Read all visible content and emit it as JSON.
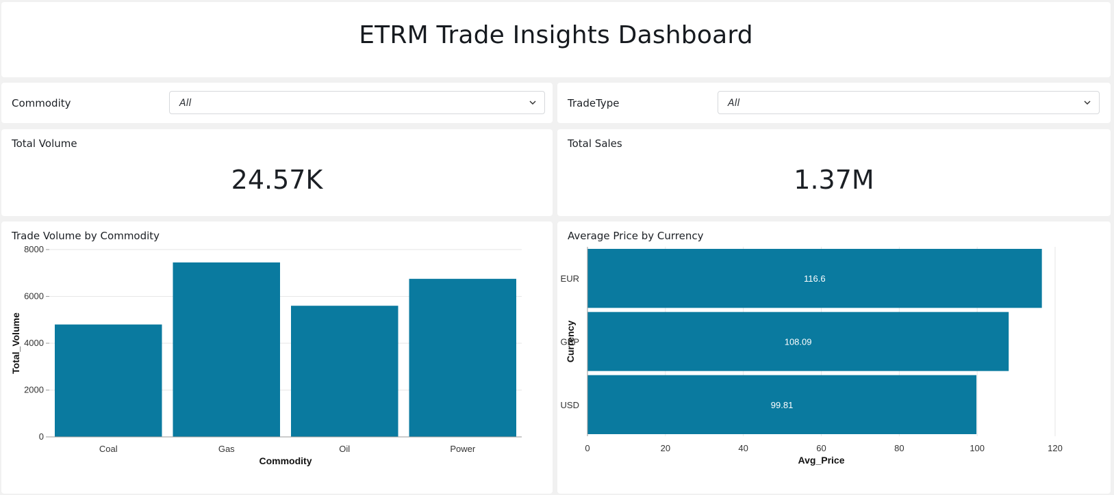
{
  "header": {
    "title": "ETRM Trade Insights Dashboard"
  },
  "filters": {
    "commodity": {
      "label": "Commodity",
      "value": "All"
    },
    "tradetype": {
      "label": "TradeType",
      "value": "All"
    }
  },
  "kpis": {
    "total_volume": {
      "label": "Total Volume",
      "value": "24.57K"
    },
    "total_sales": {
      "label": "Total Sales",
      "value": "1.37M"
    }
  },
  "colors": {
    "bar": "#0a7a9f",
    "grid": "#e6e6e6",
    "axis": "#999999"
  },
  "chart_data": [
    {
      "type": "bar",
      "title": "Trade Volume by Commodity",
      "categories": [
        "Coal",
        "Gas",
        "Oil",
        "Power"
      ],
      "values": [
        4800,
        7450,
        5600,
        6750
      ],
      "xlabel": "Commodity",
      "ylabel": "Total_Volume",
      "ylim": [
        0,
        8000
      ],
      "yticks": [
        0,
        2000,
        4000,
        6000,
        8000
      ],
      "grid": true,
      "legend": "none"
    },
    {
      "type": "bar",
      "orientation": "horizontal",
      "title": "Average Price by Currency",
      "categories": [
        "EUR",
        "GBP",
        "USD"
      ],
      "values": [
        116.6,
        108.09,
        99.81
      ],
      "data_labels": [
        "116.6",
        "108.09",
        "99.81"
      ],
      "xlabel": "Avg_Price",
      "ylabel": "Currency",
      "xlim": [
        0,
        120
      ],
      "xticks": [
        0,
        20,
        40,
        60,
        80,
        100,
        120
      ],
      "grid": true,
      "legend": "none"
    }
  ]
}
